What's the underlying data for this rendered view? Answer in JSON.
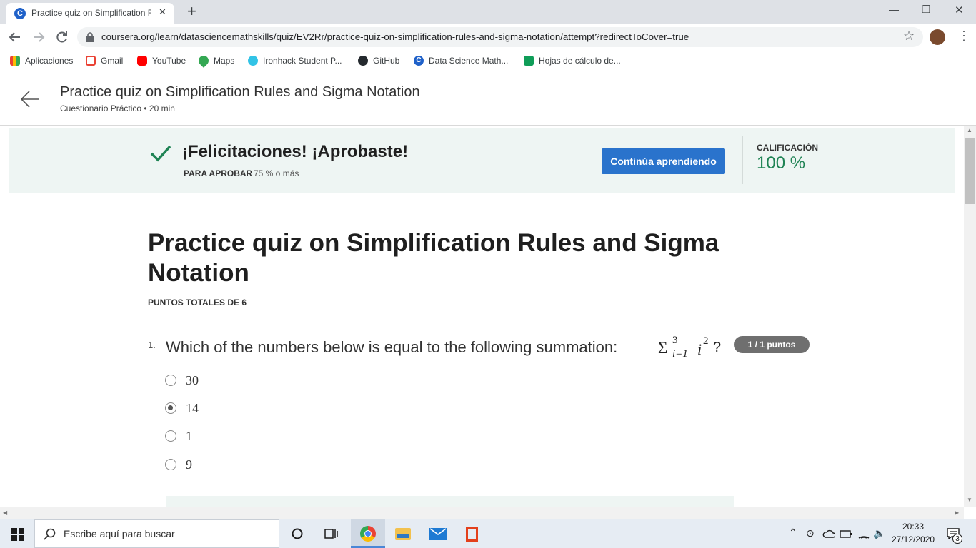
{
  "browser": {
    "tab_title": "Practice quiz on Simplification Ru",
    "tab_close": "✕",
    "new_tab": "+",
    "url": "coursera.org/learn/datasciencemathskills/quiz/EV2Rr/practice-quiz-on-simplification-rules-and-sigma-notation/attempt?redirectToCover=true",
    "bookmarks": [
      "Aplicaciones",
      "Gmail",
      "YouTube",
      "Maps",
      "Ironhack Student P...",
      "GitHub",
      "Data Science Math...",
      "Hojas de cálculo de..."
    ],
    "window_controls": {
      "minimize": "—",
      "restore": "❐",
      "close": "✕"
    }
  },
  "header": {
    "title": "Practice quiz on Simplification Rules and Sigma Notation",
    "subtitle": "Cuestionario Práctico • 20 min"
  },
  "banner": {
    "message": "¡Felicitaciones! ¡Aprobaste!",
    "pass_label": "PARA APROBAR",
    "pass_value": "75 % o más",
    "continue_button": "Continúa aprendiendo",
    "grade_label": "CALIFICACIÓN",
    "grade_value": "100 %",
    "accent_color": "#2a73cc",
    "success_color": "#1f8354"
  },
  "quiz": {
    "title": "Practice quiz on Simplification Rules and Sigma Notation",
    "total_points": "PUNTOS TOTALES DE 6",
    "question": {
      "number": "1.",
      "text": "Which of the numbers below is equal to the following summation:",
      "math": {
        "sigma": "Σ",
        "upper": "3",
        "lower": "i=1",
        "base": "i",
        "exp": "2"
      },
      "question_mark": "?",
      "points": "1 / 1 puntos",
      "options": [
        {
          "label": "30",
          "selected": false
        },
        {
          "label": "14",
          "selected": true
        },
        {
          "label": "1",
          "selected": false
        },
        {
          "label": "9",
          "selected": false
        }
      ]
    }
  },
  "taskbar": {
    "search_placeholder": "Escribe aquí para buscar",
    "time": "20:33",
    "date": "27/12/2020",
    "notification_count": "3"
  }
}
